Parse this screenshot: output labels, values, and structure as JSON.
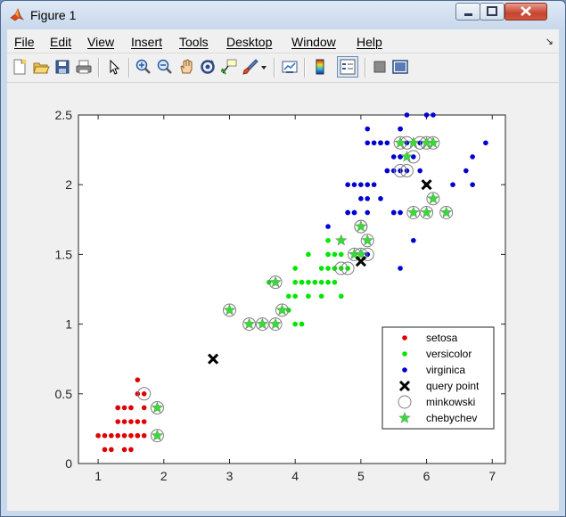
{
  "window": {
    "title": "Figure 1"
  },
  "menu": [
    "File",
    "Edit",
    "View",
    "Insert",
    "Tools",
    "Desktop",
    "Window",
    "Help"
  ],
  "toolbar_icons": [
    "new-figure-icon",
    "open-file-icon",
    "save-icon",
    "print-icon",
    "pointer-icon",
    "zoom-in-icon",
    "zoom-out-icon",
    "pan-hand-icon",
    "rotate-3d-icon",
    "data-cursor-icon",
    "brush-icon",
    "brush-dropdown-icon",
    "link-plot-icon",
    "colorbar-icon",
    "legend-icon",
    "hide-plot-tools-icon",
    "show-plot-tools-icon"
  ],
  "colors": {
    "setosa": "#e00000",
    "versicolor": "#00e600",
    "virginica": "#0000d0",
    "query": "#000000",
    "minkowski": "#808080",
    "chebychev": "#33dd33"
  },
  "chart_data": {
    "type": "scatter",
    "xlim": [
      0.7,
      7.2
    ],
    "ylim": [
      0,
      2.5
    ],
    "xticks": [
      1,
      2,
      3,
      4,
      5,
      6,
      7
    ],
    "yticks": [
      0,
      0.5,
      1,
      1.5,
      2,
      2.5
    ],
    "xtick_labels": [
      "1",
      "2",
      "3",
      "4",
      "5",
      "6",
      "7"
    ],
    "ytick_labels": [
      "0",
      "0.5",
      "1",
      "1.5",
      "2",
      "2.5"
    ],
    "grid": false,
    "legend_position": "bottom-right",
    "series": [
      {
        "name": "setosa",
        "marker": "dot",
        "x": [
          1.1,
          1.2,
          1.3,
          1.4,
          1.5,
          1.6,
          1.7,
          1.0,
          1.9,
          1.3,
          1.4,
          1.5,
          1.6,
          1.7,
          1.3,
          1.4,
          1.5,
          1.7,
          1.3,
          1.5,
          1.6,
          1.6,
          1.9,
          1.5,
          1.4,
          1.9,
          1.7,
          1.2,
          1.6,
          1.1
        ],
        "y": [
          0.2,
          0.2,
          0.2,
          0.2,
          0.2,
          0.2,
          0.2,
          0.2,
          0.2,
          0.3,
          0.3,
          0.3,
          0.3,
          0.3,
          0.4,
          0.4,
          0.4,
          0.4,
          0.4,
          0.1,
          0.2,
          0.6,
          0.4,
          0.4,
          0.1,
          0.4,
          0.5,
          0.1,
          0.5,
          0.1
        ]
      },
      {
        "name": "versicolor",
        "marker": "dot",
        "x": [
          3.0,
          3.3,
          3.5,
          3.6,
          3.7,
          3.8,
          3.9,
          4.0,
          4.2,
          3.9,
          4.0,
          4.1,
          4.2,
          4.3,
          4.4,
          4.5,
          4.6,
          4.0,
          4.5,
          4.7,
          4.1,
          4.4,
          4.6,
          4.8,
          4.9,
          5.0,
          4.7,
          4.4,
          4.2,
          4.7,
          4.5,
          4.9,
          5.1,
          4.8,
          4.5,
          4.6,
          4.7,
          4.3,
          4.1,
          4.0,
          3.8,
          4.5,
          4.6
        ],
        "y": [
          1.1,
          1.0,
          1.0,
          1.3,
          1.0,
          1.1,
          1.1,
          1.0,
          1.2,
          1.2,
          1.2,
          1.3,
          1.3,
          1.3,
          1.3,
          1.3,
          1.3,
          1.4,
          1.4,
          1.4,
          1.0,
          1.4,
          1.4,
          1.4,
          1.5,
          1.7,
          1.5,
          1.2,
          1.5,
          1.6,
          1.5,
          1.5,
          1.6,
          1.8,
          1.6,
          1.5,
          1.2,
          1.3,
          1.3,
          1.3,
          1.1,
          1.5,
          1.4
        ]
      },
      {
        "name": "virginica",
        "marker": "dot",
        "x": [
          6.0,
          5.1,
          5.9,
          5.6,
          5.8,
          6.6,
          4.5,
          6.3,
          5.8,
          6.1,
          5.1,
          5.3,
          5.5,
          5.0,
          5.1,
          5.3,
          5.5,
          6.7,
          6.9,
          5.0,
          5.7,
          4.9,
          6.7,
          4.9,
          5.7,
          6.0,
          4.8,
          4.9,
          5.6,
          5.8,
          6.1,
          6.4,
          5.6,
          5.1,
          5.6,
          6.1,
          5.6,
          5.5,
          4.8,
          5.4,
          5.6,
          5.1,
          5.9,
          5.7,
          5.2,
          5.0,
          5.2,
          5.4,
          5.1,
          4.8,
          5.6,
          5.8,
          5.4,
          6.0,
          5.5,
          5.3,
          5.7
        ],
        "y": [
          2.5,
          1.9,
          2.1,
          1.8,
          2.2,
          2.1,
          1.7,
          1.8,
          1.8,
          2.5,
          2.0,
          1.9,
          2.1,
          2.0,
          2.4,
          2.3,
          1.8,
          2.2,
          2.3,
          1.5,
          2.3,
          2.0,
          2.0,
          1.8,
          2.1,
          1.8,
          1.8,
          1.8,
          2.1,
          1.6,
          1.9,
          2.0,
          2.2,
          1.5,
          1.4,
          2.3,
          2.4,
          1.8,
          1.8,
          2.1,
          2.4,
          2.3,
          2.3,
          2.5,
          2.3,
          1.9,
          2.0,
          2.3,
          1.8,
          2.0,
          2.2,
          2.3,
          2.1,
          2.0,
          2.2,
          2.3,
          2.2
        ]
      },
      {
        "name": "query point",
        "marker": "x",
        "x": [
          2.75,
          5.0,
          6.0
        ],
        "y": [
          0.75,
          1.45,
          2.0
        ]
      },
      {
        "name": "minkowski",
        "marker": "circle",
        "x": [
          1.7,
          1.9,
          1.9,
          3.0,
          3.7,
          3.3,
          3.5,
          3.7,
          3.8,
          4.7,
          4.8,
          4.9,
          5.0,
          5.1,
          5.0,
          5.1,
          5.0,
          5.6,
          5.7,
          5.8,
          5.9,
          6.0,
          6.1,
          5.6,
          5.7,
          5.8,
          6.0,
          6.1,
          6.3
        ],
        "y": [
          0.5,
          0.4,
          0.2,
          1.1,
          1.3,
          1.0,
          1.0,
          1.0,
          1.1,
          1.4,
          1.4,
          1.5,
          1.5,
          1.5,
          1.7,
          1.6,
          1.7,
          2.3,
          2.3,
          2.2,
          2.3,
          2.3,
          2.3,
          2.1,
          2.1,
          1.8,
          1.8,
          1.9,
          1.8
        ]
      },
      {
        "name": "chebychev",
        "marker": "star",
        "x": [
          1.9,
          1.9,
          3.0,
          3.3,
          3.5,
          3.7,
          3.8,
          3.7,
          4.7,
          5.0,
          5.1,
          4.9,
          5.0,
          5.6,
          5.8,
          6.0,
          6.1,
          5.8,
          6.0,
          6.1,
          6.3,
          5.7
        ],
        "y": [
          0.4,
          0.2,
          1.1,
          1.0,
          1.0,
          1.0,
          1.1,
          1.3,
          1.6,
          1.7,
          1.6,
          1.5,
          1.5,
          2.3,
          2.3,
          2.3,
          2.3,
          1.8,
          1.8,
          1.9,
          1.8,
          2.2
        ]
      }
    ]
  }
}
